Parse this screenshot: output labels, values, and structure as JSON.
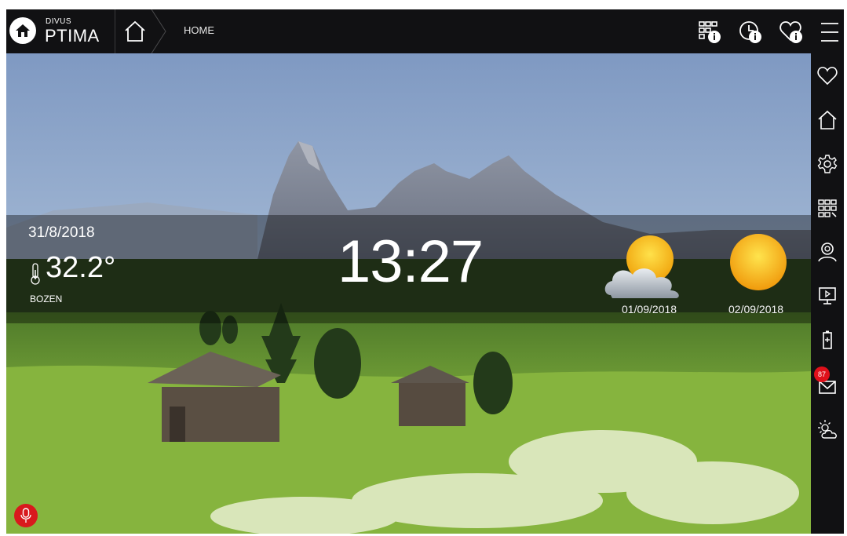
{
  "app": {
    "logo_small": "DIVUS",
    "logo_big": "PTIMA"
  },
  "header": {
    "breadcrumb": "HOME",
    "icons": [
      "room-info-icon",
      "clock-info-icon",
      "favorite-info-icon",
      "menu-icon"
    ]
  },
  "info": {
    "date": "31/8/2018",
    "temperature": "32.2°",
    "city": "BOZEN",
    "time": "13:27"
  },
  "forecast": [
    {
      "date": "01/09/2018",
      "icon": "partly-cloudy-icon"
    },
    {
      "date": "02/09/2018",
      "icon": "sunny-icon"
    }
  ],
  "sidebar": {
    "items": [
      "favorites-icon",
      "home-icon",
      "settings-icon",
      "rooms-icon",
      "user-icon",
      "media-icon",
      "battery-icon",
      "mail-icon",
      "weather-icon"
    ],
    "mail_badge": "87"
  },
  "colors": {
    "bar": "#111113",
    "accent_red": "#d8191d",
    "badge_red": "#e0101a"
  }
}
